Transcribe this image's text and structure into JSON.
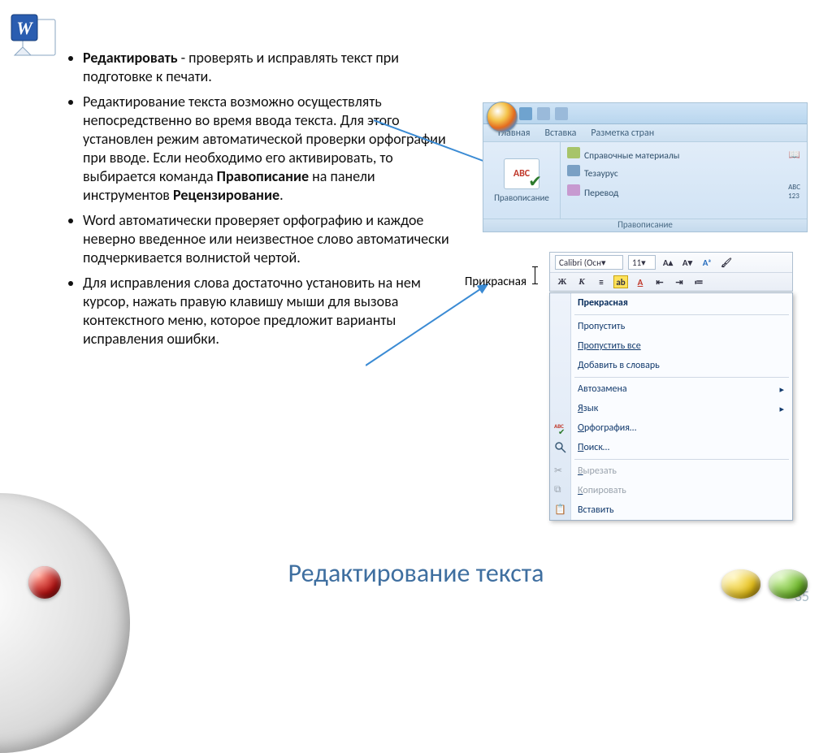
{
  "bullets": {
    "b1_bold": "Редактировать",
    "b1_rest": " - проверять и исправлять текст при подготовке к печати.",
    "b2_a": "Редактирование текста возможно  осуществлять непосредственно во время ввода текста. Для этого установлен режим автоматической проверки орфографии при вводе. Если необходимо его активировать, то выбирается команда ",
    "b2_bold1": "Правописание",
    "b2_mid": " на панели инструментов ",
    "b2_bold2": "Рецензирование",
    "b2_end": ".",
    "b3": "Word автоматически проверяет орфографию и каждое неверно введенное или неизвестное слово автоматически подчеркивается волнистой чертой.",
    "b4": "Для исправления слова достаточно установить на нем курсор, нажать правую клавишу мыши для вызова контекстного меню, которое предложит варианты исправления ошибки."
  },
  "ribbon": {
    "tabs": [
      "Главная",
      "Вставка",
      "Разметка стран"
    ],
    "abc": "ABC",
    "spellcheck_label": "Правописание",
    "rows": {
      "r1": "Справочные материалы",
      "r2": "Тезаурус",
      "r3": "Перевод"
    },
    "footer": "Правописание"
  },
  "mini": {
    "font": "Calibri (Осн",
    "size": "11"
  },
  "misspelled": "Прикрасная",
  "context_menu": {
    "suggestion": "Прекрасная",
    "skip": "Пропустить",
    "skip_all": "Пропустить все",
    "add_u": "Д",
    "add_rest": "обавить в словарь",
    "autocorrect": "Автозамена",
    "lang_u": "Я",
    "lang_rest": "зык",
    "spell_u": "О",
    "spell_rest": "рфография…",
    "find_u": "П",
    "find_rest": "оиск…",
    "cut_u": "В",
    "cut_rest": "ырезать",
    "copy_u": "К",
    "copy_rest": "опировать",
    "paste": "Вставить"
  },
  "title": "Редактирование текста",
  "page_number": "35"
}
